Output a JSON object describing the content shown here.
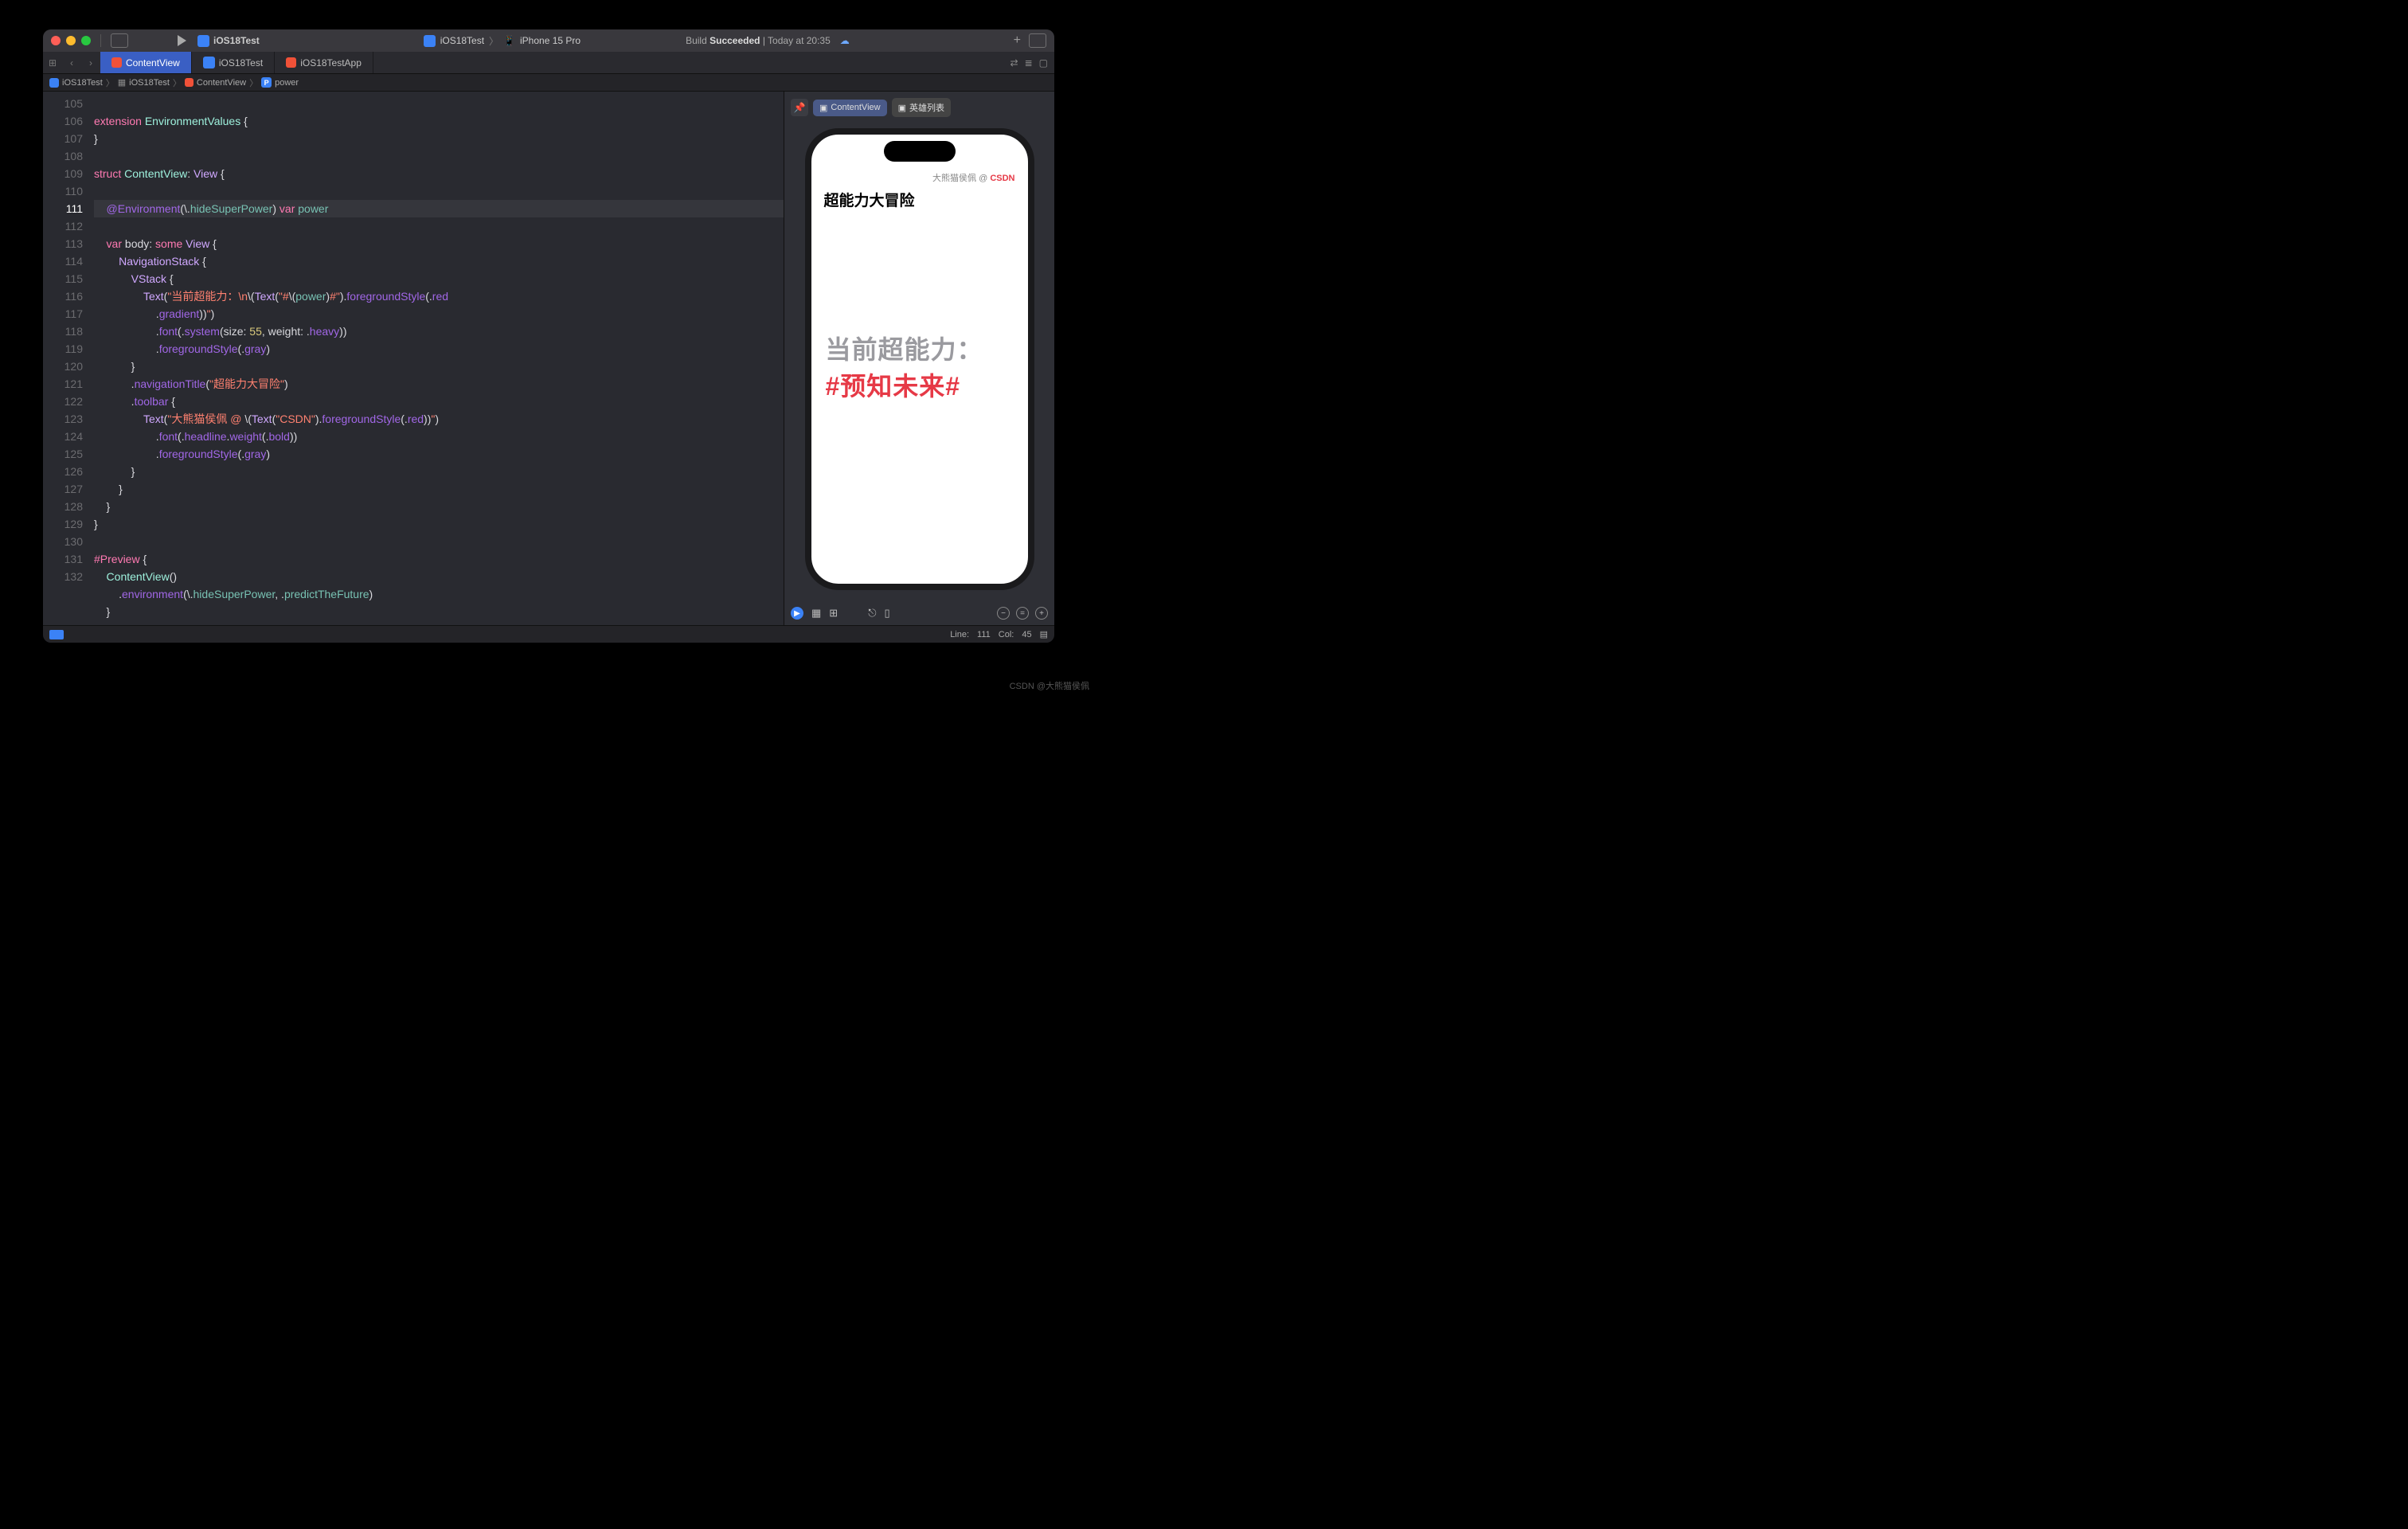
{
  "titlebar": {
    "project": "iOS18Test",
    "scheme_left": "iOS18Test",
    "scheme_right": "iPhone 15 Pro",
    "status_prefix": "Build ",
    "status_bold": "Succeeded",
    "status_suffix": " | Today at 20:35"
  },
  "tabs": {
    "nav_grid": "⊞",
    "back": "‹",
    "fwd": "›",
    "active": "ContentView",
    "t1": "iOS18Test",
    "t2": "iOS18TestApp"
  },
  "crumb": {
    "c0": "iOS18Test",
    "c1": "iOS18Test",
    "c2": "ContentView",
    "c3_badge": "P",
    "c3": "power"
  },
  "lines": [
    "105",
    "106",
    "107",
    "108",
    "109",
    "110",
    "111",
    "112",
    "113",
    "114",
    "115",
    "116",
    "",
    "117",
    "118",
    "119",
    "120",
    "121",
    "122",
    "123",
    "124",
    "125",
    "126",
    "127",
    "128",
    "129",
    "130",
    "131",
    "132",
    ""
  ],
  "code": {
    "l105a": "extension",
    "l105b": " EnvironmentValues",
    "l105c": " {",
    "l106": "}",
    "l108a": "struct",
    "l108b": " ContentView",
    "l108c": ": ",
    "l108d": "View",
    "l108e": " {",
    "l110a": "    @Environment",
    "l110b": "(\\.",
    "l110c": "hideSuperPower",
    "l110d": ") ",
    "l110e": "var",
    "l110f": " power",
    "l112a": "    var",
    "l112b": " body: ",
    "l112c": "some",
    "l112d": " View",
    "l112e": " {",
    "l113a": "        NavigationStack",
    "l113b": " {",
    "l114a": "            VStack",
    "l114b": " {",
    "l115a": "                Text",
    "l115b": "(",
    "l115c": "\"当前超能力：\\n",
    "l115d": "\\(",
    "l115e": "Text",
    "l115f": "(",
    "l115g": "\"#",
    "l115h": "\\(",
    "l115i": "power",
    "l115j": ")",
    "l115k": "#\"",
    "l115l": ").",
    "l115m": "foregroundStyle",
    "l115n": "(.",
    "l115o": "red",
    "l115p": "                    .",
    "l115q": "gradient",
    "l115r": "))",
    "l115s": "\"",
    "l115t": ")",
    "l116a": "                    .",
    "l116b": "font",
    "l116c": "(.",
    "l116d": "system",
    "l116e": "(size: ",
    "l116f": "55",
    "l116g": ", weight: .",
    "l116h": "heavy",
    "l116i": "))",
    "l117a": "                    .",
    "l117b": "foregroundStyle",
    "l117c": "(.",
    "l117d": "gray",
    "l117e": ")",
    "l118": "            }",
    "l119a": "            .",
    "l119b": "navigationTitle",
    "l119c": "(",
    "l119d": "\"超能力大冒险\"",
    "l119e": ")",
    "l120a": "            .",
    "l120b": "toolbar",
    "l120c": " {",
    "l121a": "                Text",
    "l121b": "(",
    "l121c": "\"大熊猫侯佩 @ ",
    "l121d": "\\(",
    "l121e": "Text",
    "l121f": "(",
    "l121g": "\"CSDN\"",
    "l121h": ").",
    "l121i": "foregroundStyle",
    "l121j": "(.",
    "l121k": "red",
    "l121l": "))",
    "l121m": "\"",
    "l121n": ")",
    "l122a": "                    .",
    "l122b": "font",
    "l122c": "(.",
    "l122d": "headline",
    "l122e": ".",
    "l122f": "weight",
    "l122g": "(.",
    "l122h": "bold",
    "l122i": "))",
    "l123a": "                    .",
    "l123b": "foregroundStyle",
    "l123c": "(.",
    "l123d": "gray",
    "l123e": ")",
    "l124": "            }",
    "l125": "        }",
    "l126": "    }",
    "l127": "}",
    "l129a": "#Preview",
    "l129b": " {",
    "l130a": "    ContentView",
    "l130b": "()",
    "l131a": "        .",
    "l131b": "environment",
    "l131c": "(\\.",
    "l131d": "hideSuperPower",
    "l131e": ", .",
    "l131f": "predictTheFuture",
    "l131g": ")",
    "l132": "    }"
  },
  "preview": {
    "pin": "📌",
    "chip1": "ContentView",
    "chip2": "英雄列表",
    "toolbar_author": "大熊猫侯佩 @ ",
    "toolbar_brand": "CSDN",
    "title": "超能力大冒险",
    "body_l1": "当前超能力：",
    "body_l2": "#预知未来#"
  },
  "bottom": {
    "line_label": "Line:",
    "line": "111",
    "col_label": "Col:",
    "col": "45"
  },
  "watermark": "CSDN @大熊猫侯佩"
}
